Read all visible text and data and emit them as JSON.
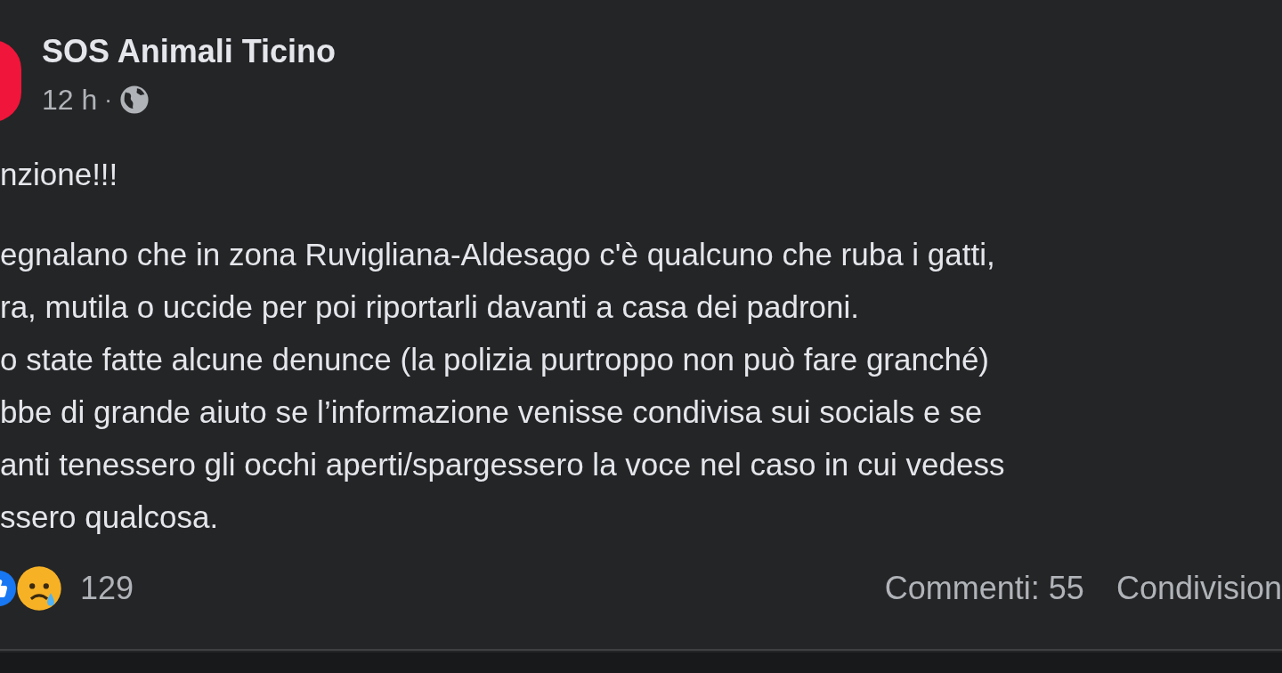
{
  "post": {
    "author": "SOS Animali Ticino",
    "time": "12 h",
    "separator": "·",
    "lines": [
      "nzione!!!",
      "egnalano che in zona Ruvigliana-Aldesago c'è qualcuno che ruba i gatti,",
      "ra, mutila o uccide per poi riportarli davanti a casa dei padroni.",
      "o state fatte alcune denunce (la polizia purtroppo non può fare granché)",
      "bbe di grande aiuto se l’informazione venisse condivisa sui socials e se",
      "anti tenessero gli occhi aperti/spargessero la voce nel caso in cui vedess",
      "ssero qualcosa."
    ],
    "reactions": [
      {
        "kind": "like"
      },
      {
        "kind": "sad"
      }
    ],
    "reaction_count": "129",
    "comments": "Commenti: 55",
    "shares": "Condivision"
  }
}
